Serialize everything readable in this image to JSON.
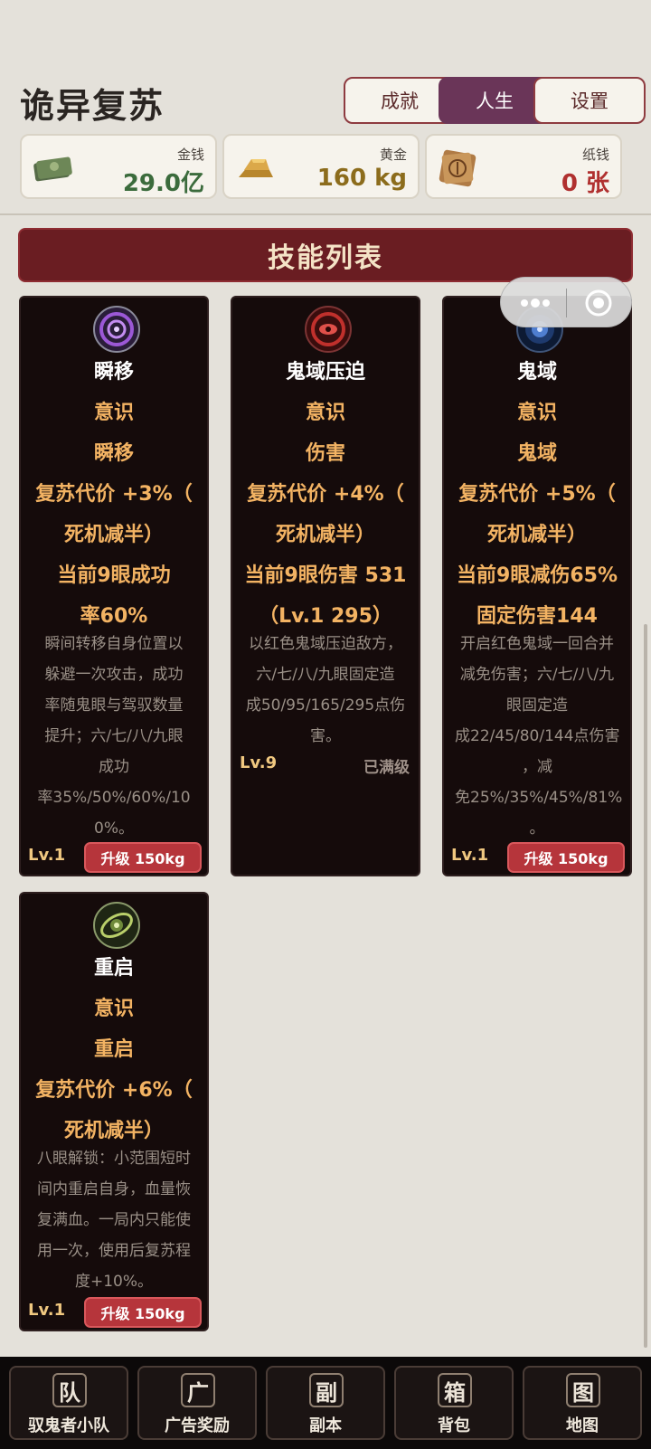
{
  "app": {
    "title": "诡异复苏"
  },
  "header_buttons": [
    {
      "label": "成就",
      "active": false
    },
    {
      "label": "人生",
      "active": true
    },
    {
      "label": "设置",
      "active": false
    }
  ],
  "resources": [
    {
      "label": "金钱",
      "value": "29.0亿",
      "value_color": "#3b6b3c",
      "icon": "cash-icon"
    },
    {
      "label": "黄金",
      "value": "160 kg",
      "value_color": "#8c6c1c",
      "icon": "gold-bar-icon"
    },
    {
      "label": "纸钱",
      "value": "0 张",
      "value_color": "#b0302f",
      "icon": "paper-money-icon"
    }
  ],
  "section_title": "技能列表",
  "skills": [
    {
      "emblem": "purple-vortex-icon",
      "name": "瞬移",
      "category": "意识",
      "type": "瞬移",
      "cost_lines": [
        "复苏代价 +3%（",
        "死机减半）"
      ],
      "effect_lines": [
        "当前9眼成功",
        "率60%"
      ],
      "desc_lines": [
        "瞬间转移自身位置以",
        "躲避一次攻击，成功",
        "率随鬼眼与驾驭数量",
        "提升；六/七/八/九眼",
        "成功",
        "率35%/50%/60%/10",
        "0%。"
      ],
      "level": "Lv.1",
      "upgrade_label": "升级 150kg"
    },
    {
      "emblem": "red-eye-vortex-icon",
      "name": "鬼域压迫",
      "category": "意识",
      "type": "伤害",
      "cost_lines": [
        "复苏代价 +4%（",
        "死机减半）"
      ],
      "effect_lines": [
        "当前9眼伤害 531",
        "（Lv.1 295）"
      ],
      "desc_lines": [
        "以红色鬼域压迫敌方，",
        "六/七/八/九眼固定造",
        "成50/95/165/295点伤",
        "害。"
      ],
      "level": "Lv.9",
      "maxed_label": "已满级"
    },
    {
      "emblem": "blue-domain-icon",
      "name": "鬼域",
      "category": "意识",
      "type": "鬼域",
      "cost_lines": [
        "复苏代价 +5%（",
        "死机减半）"
      ],
      "effect_lines": [
        "当前9眼减伤65%",
        "固定伤害144"
      ],
      "desc_lines": [
        "开启红色鬼域一回合并",
        "减免伤害；六/七/八/九",
        "眼固定造",
        "成22/45/80/144点伤害",
        "，减",
        "免25%/35%/45%/81%",
        "。"
      ],
      "level": "Lv.1",
      "upgrade_label": "升级 150kg"
    },
    {
      "emblem": "green-rune-icon",
      "name": "重启",
      "category": "意识",
      "type": "重启",
      "cost_lines": [
        "复苏代价 +6%（",
        "死机减半）"
      ],
      "effect_lines": [],
      "desc_lines": [
        "八眼解锁：小范围短时",
        "间内重启自身，血量恢",
        "复满血。一局内只能使",
        "用一次，使用后复苏程",
        "度+10%。"
      ],
      "level": "Lv.1",
      "upgrade_label": "升级 150kg"
    }
  ],
  "bottom_nav": [
    {
      "glyph": "队",
      "label": "驭鬼者小队"
    },
    {
      "glyph": "广",
      "label": "广告奖励"
    },
    {
      "glyph": "副",
      "label": "副本"
    },
    {
      "glyph": "箱",
      "label": "背包"
    },
    {
      "glyph": "图",
      "label": "地图"
    }
  ]
}
